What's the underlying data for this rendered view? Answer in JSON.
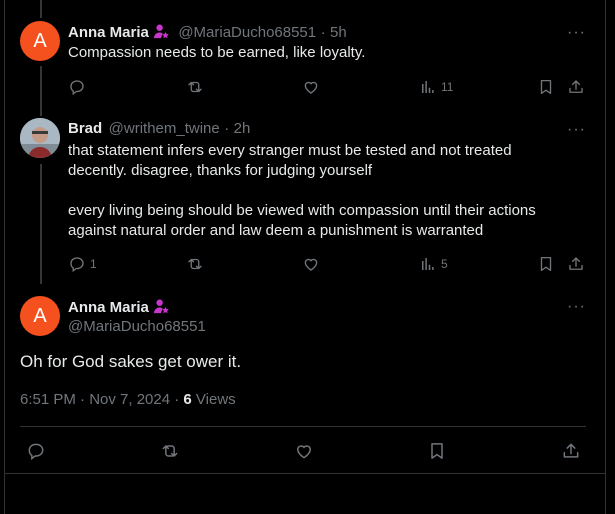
{
  "tweet1": {
    "avatar_letter": "A",
    "name": "Anna Maria",
    "handle": "@MariaDucho68551",
    "sep": "·",
    "time": "5h",
    "text": "Compassion  needs to be earned, like loyalty.",
    "views": "11"
  },
  "tweet2": {
    "name": "Brad",
    "handle": "@writhem_twine",
    "sep": "·",
    "time": "2h",
    "line1": "that statement infers every stranger must be tested and not treated",
    "line2": "decently. disagree, thanks for judging yourself",
    "line3": "every living being should be viewed with compassion until their actions",
    "line4": "against natural order and law deem a punishment is warranted",
    "replies": "1",
    "views": "5"
  },
  "main": {
    "avatar_letter": "A",
    "name": "Anna Maria",
    "handle": "@MariaDucho68551",
    "text": "Oh for God sakes get ower it.",
    "timestamp": "6:51 PM · Nov 7, 2024 · ",
    "views_count": "6",
    "views_label": " Views"
  },
  "more_glyph": "···",
  "colors": {
    "avatar": "#f4511e",
    "badge": "#c936cc",
    "muted": "#71767b"
  },
  "icons": [
    "reply-icon",
    "repost-icon",
    "like-icon",
    "views-icon",
    "bookmark-icon",
    "share-icon",
    "more-icon",
    "affiliate-badge-icon"
  ]
}
